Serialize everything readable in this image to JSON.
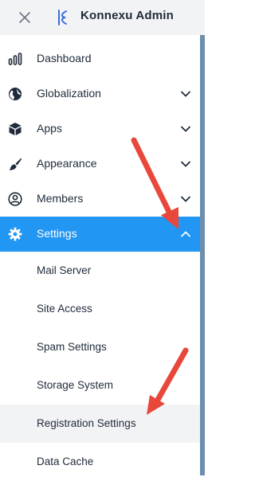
{
  "header": {
    "title": "Konnexu Admin"
  },
  "nav": {
    "dashboard": "Dashboard",
    "globalization": "Globalization",
    "apps": "Apps",
    "appearance": "Appearance",
    "members": "Members",
    "settings": "Settings"
  },
  "settings_sub": {
    "mail_server": "Mail Server",
    "site_access": "Site Access",
    "spam_settings": "Spam Settings",
    "storage_system": "Storage System",
    "registration_settings": "Registration Settings",
    "data_cache": "Data Cache"
  },
  "colors": {
    "accent": "#2196f3",
    "header_bg": "#f2f3f5",
    "text": "#1f2b3a",
    "annotation_arrow": "#e8483b"
  },
  "icons": [
    "close-icon",
    "konnexu-logo-icon",
    "bar-chart-icon",
    "globe-icon",
    "cube-icon",
    "brush-icon",
    "user-circle-icon",
    "gear-icon",
    "chevron-down-icon",
    "chevron-up-icon"
  ]
}
